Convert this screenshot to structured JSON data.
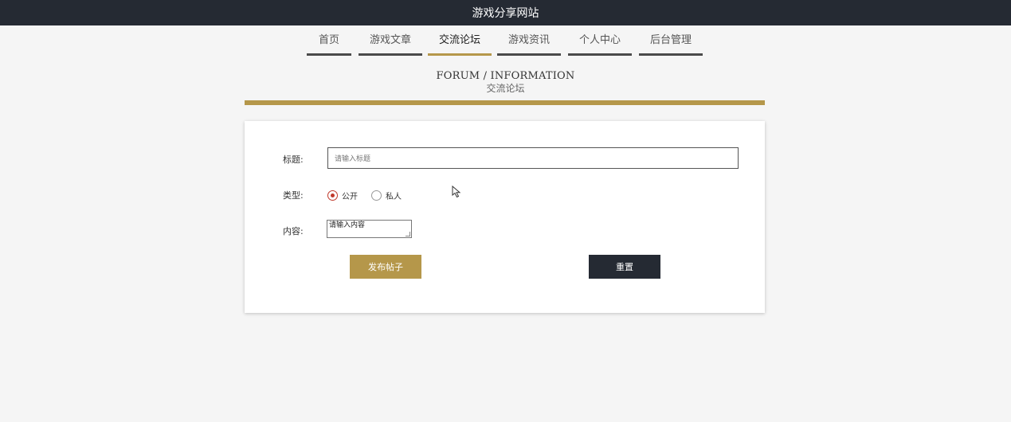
{
  "site": {
    "title": "游戏分享网站"
  },
  "nav": {
    "items": [
      {
        "label": "首页"
      },
      {
        "label": "游戏文章"
      },
      {
        "label": "交流论坛"
      },
      {
        "label": "游戏资讯"
      },
      {
        "label": "个人中心"
      },
      {
        "label": "后台管理"
      }
    ],
    "active": "交流论坛"
  },
  "section": {
    "title_en": "FORUM / INFORMATION",
    "title_cn": "交流论坛"
  },
  "form": {
    "title_label": "标题:",
    "title_placeholder": "请输入标题",
    "type_label": "类型:",
    "type_options": [
      "公开",
      "私人"
    ],
    "type_selected": "公开",
    "content_label": "内容:",
    "content_placeholder": "请输入内容",
    "submit_label": "发布帖子",
    "reset_label": "重置"
  },
  "colors": {
    "accent": "#b5974a",
    "dark": "#252a33",
    "radio": "#c0392b"
  },
  "icons": {
    "pointer": "mouse-pointer-icon"
  }
}
